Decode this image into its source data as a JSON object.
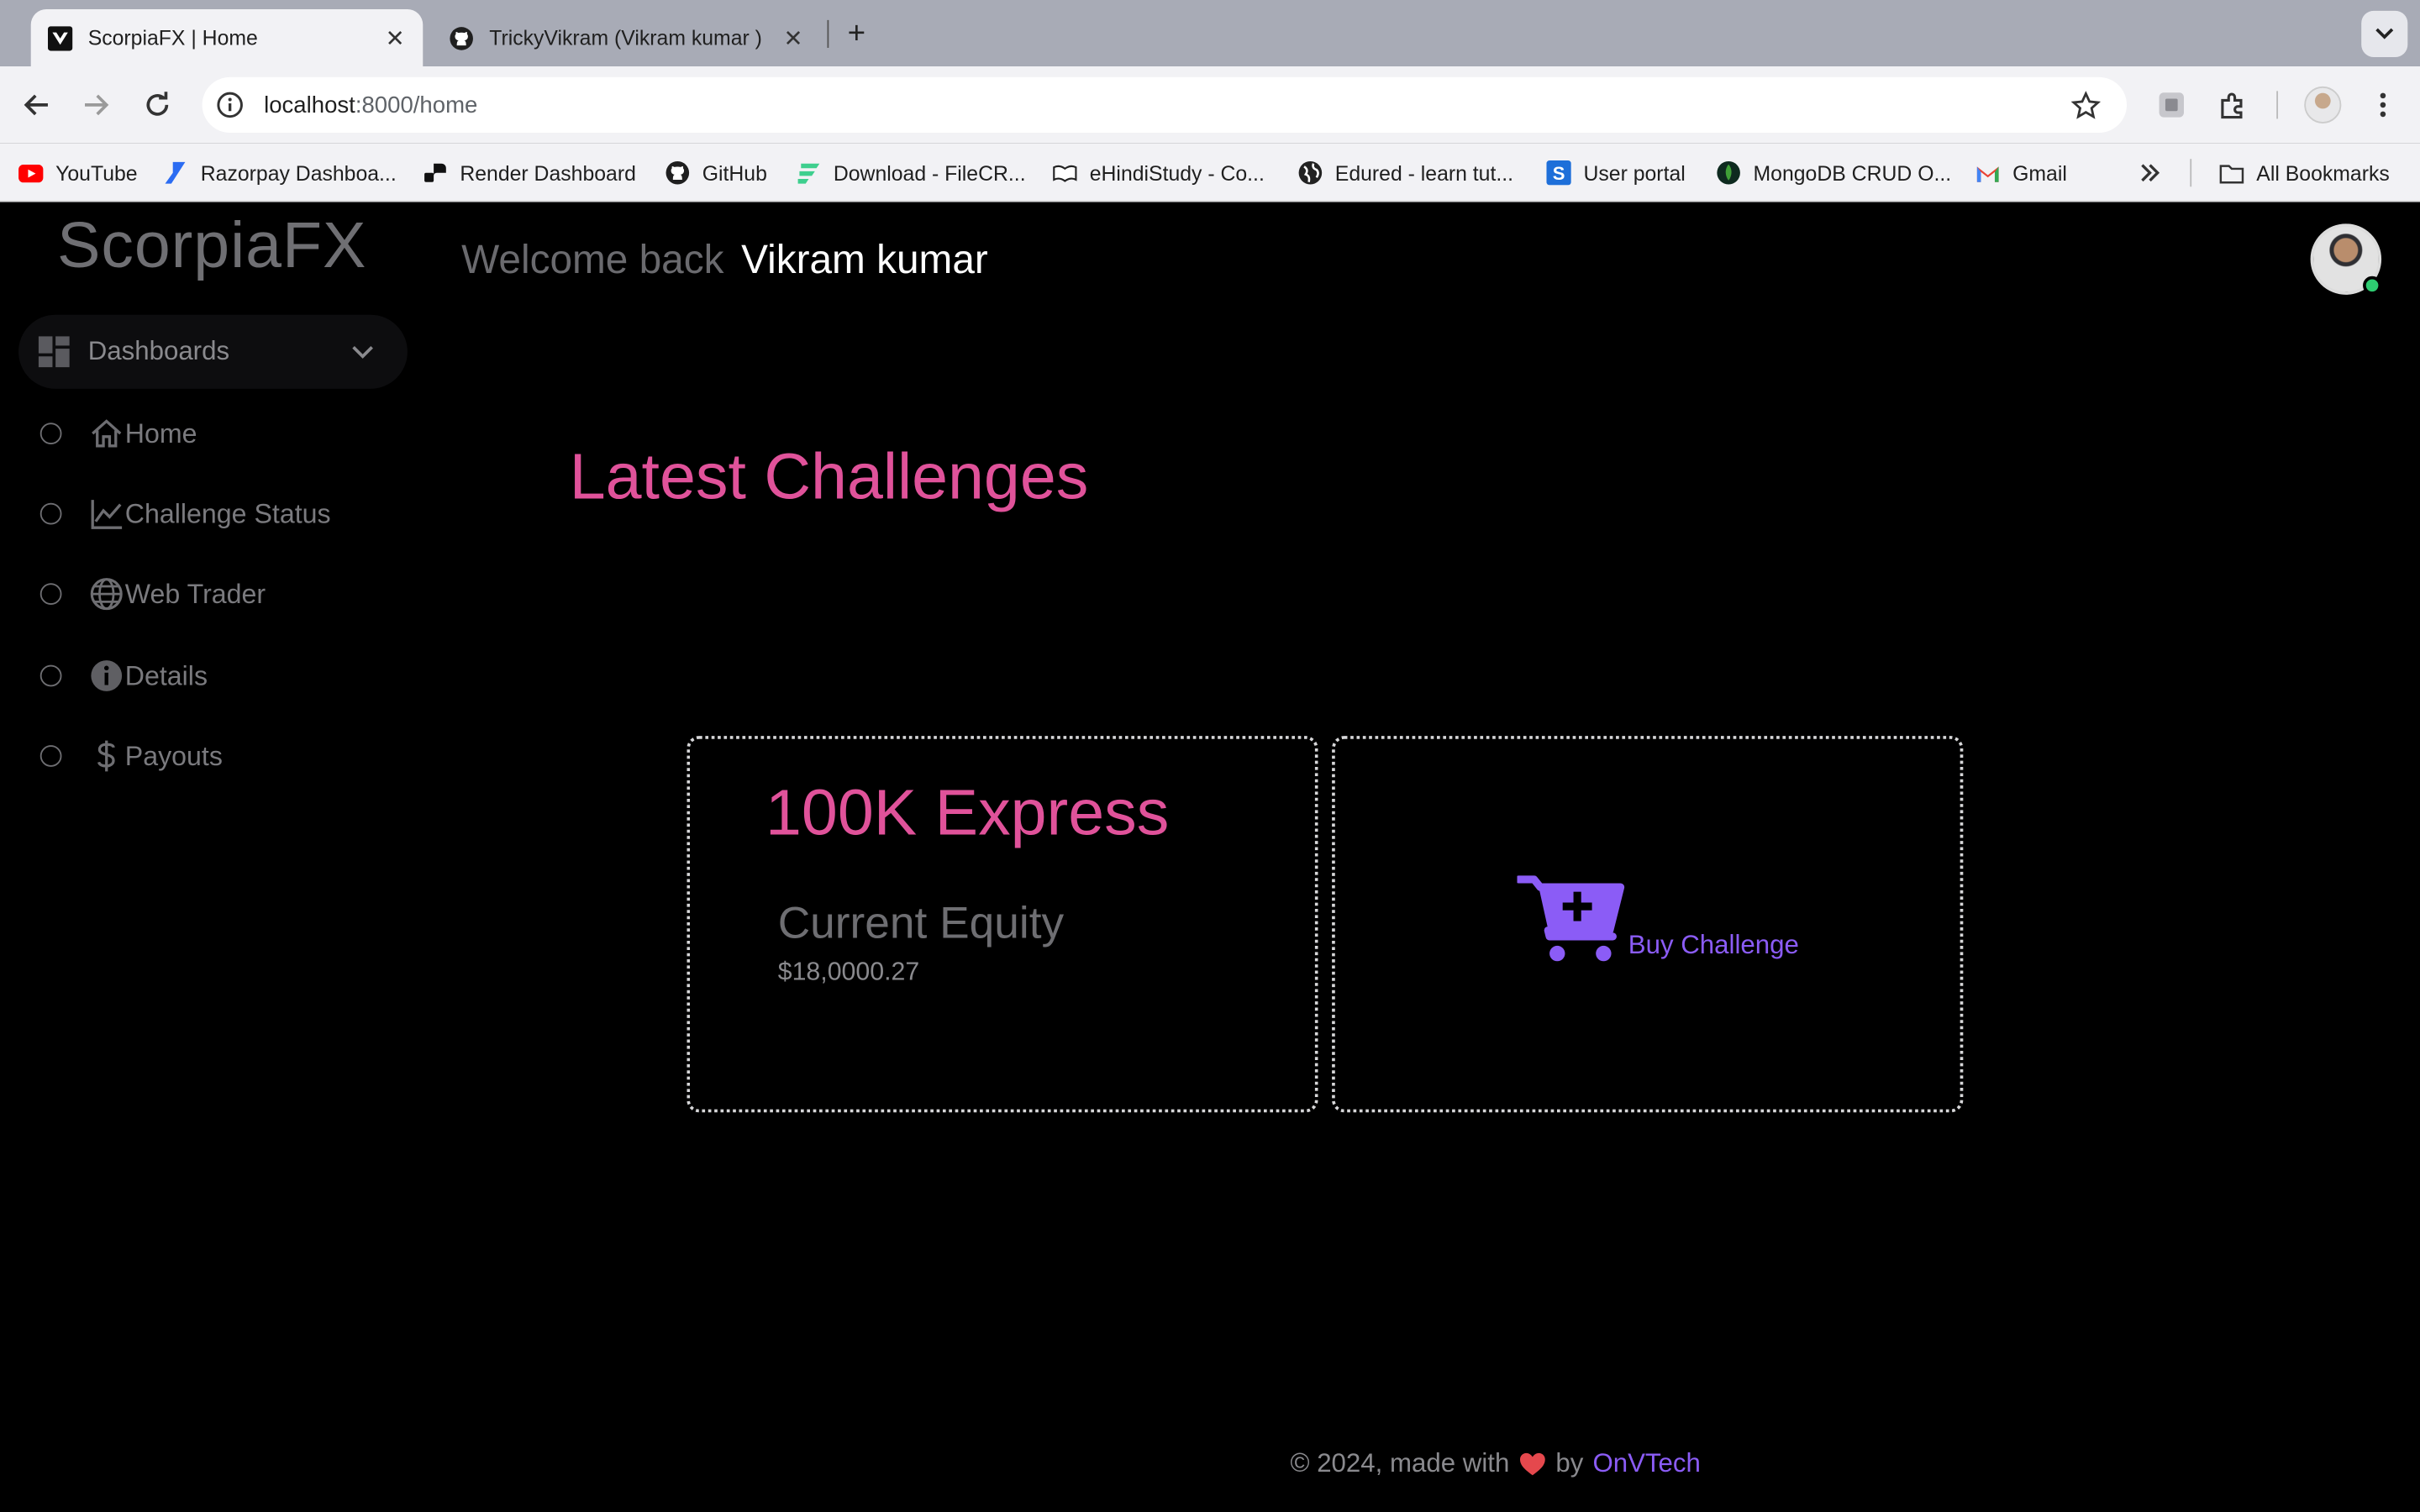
{
  "browser": {
    "tabs": [
      {
        "title": "ScorpiaFX | Home",
        "active": true
      },
      {
        "title": "TrickyVikram (Vikram kumar )",
        "active": false
      }
    ],
    "url": {
      "host": "localhost",
      "path": ":8000/home"
    },
    "bookmarks": [
      {
        "label": "YouTube",
        "icon": "youtube-icon"
      },
      {
        "label": "Razorpay Dashboa...",
        "icon": "razorpay-icon"
      },
      {
        "label": "Render Dashboard",
        "icon": "render-icon"
      },
      {
        "label": "GitHub",
        "icon": "github-icon"
      },
      {
        "label": "Download - FileCR...",
        "icon": "filecr-icon"
      },
      {
        "label": "eHindiStudy - Co...",
        "icon": "ehindistudy-icon"
      },
      {
        "label": "Edured - learn tut...",
        "icon": "globe-icon"
      },
      {
        "label": "User portal",
        "icon": "user-portal-icon"
      },
      {
        "label": "MongoDB CRUD O...",
        "icon": "mongodb-icon"
      },
      {
        "label": "Gmail",
        "icon": "gmail-icon"
      }
    ],
    "all_bookmarks_label": "All Bookmarks"
  },
  "app": {
    "brand": "ScorpiaFX",
    "welcome_prefix": "Welcome back",
    "user_name": "Vikram kumar",
    "sidebar": {
      "group_label": "Dashboards",
      "items": [
        {
          "label": "Home",
          "icon": "home-icon"
        },
        {
          "label": "Challenge Status",
          "icon": "chart-line-icon"
        },
        {
          "label": "Web Trader",
          "icon": "globe-icon"
        },
        {
          "label": "Details",
          "icon": "info-icon"
        },
        {
          "label": "Payouts",
          "icon": "dollar-icon"
        }
      ]
    },
    "section_title": "Latest Challenges",
    "challenge_card": {
      "title": "100K Express",
      "metric_label": "Current Equity",
      "metric_value": "$18,0000.27"
    },
    "buy_card": {
      "label": "Buy Challenge",
      "icon": "cart-plus-icon"
    },
    "footer": {
      "prefix": "© 2024, made with",
      "by": "by",
      "brand": "OnVTech"
    },
    "colors": {
      "accent_pink": "#e0529a",
      "accent_purple": "#8b5cf6",
      "background": "#000000",
      "online": "#2ecc71"
    }
  }
}
